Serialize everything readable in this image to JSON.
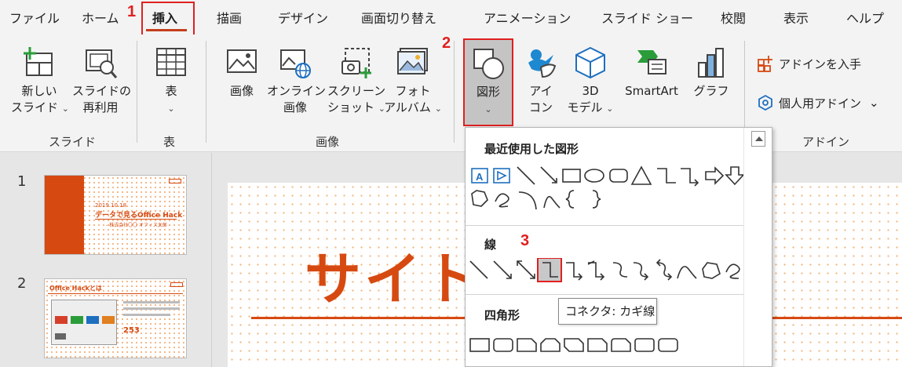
{
  "tabs": [
    "ファイル",
    "ホーム",
    "挿入",
    "描画",
    "デザイン",
    "画面切り替え",
    "アニメーション",
    "スライド ショー",
    "校閲",
    "表示",
    "ヘルプ"
  ],
  "steps": [
    "1",
    "2",
    "3"
  ],
  "ribbon": {
    "new_slide": [
      "新しい",
      "スライド"
    ],
    "reuse_slide": [
      "スライドの",
      "再利用"
    ],
    "table": "表",
    "picture": "画像",
    "online_picture": [
      "オンライン",
      "画像"
    ],
    "screenshot": [
      "スクリーン",
      "ショット"
    ],
    "photo_album": [
      "フォト",
      "アルバム"
    ],
    "shapes": "図形",
    "icons": [
      "アイ",
      "コン"
    ],
    "models3d": [
      "3D",
      "モデル"
    ],
    "smartart": "SmartArt",
    "chart": "グラフ",
    "get_addins": "アドインを入手",
    "my_addins": "個人用アドイン",
    "groups": {
      "slides": "スライド",
      "tables": "表",
      "images": "画像",
      "addins": "アドイン"
    }
  },
  "slides": {
    "numbers": [
      "1",
      "2"
    ],
    "thumb1": {
      "date": "2019.10.18",
      "title": "データで見るOffice Hack",
      "subtitle": "- 株式会社〇〇 オフィス太郎 -"
    },
    "thumb2": {
      "title": "Office Hackとは",
      "stat": "253"
    },
    "main_title": "サイト"
  },
  "dropdown": {
    "recent": "最近使用した図形",
    "lines": "線",
    "rectangles": "四角形",
    "tooltip": "コネクタ: カギ線"
  },
  "colors": {
    "accent": "#d64a12",
    "highlight": "#e02020",
    "tab_underline": "#c43e1c"
  }
}
